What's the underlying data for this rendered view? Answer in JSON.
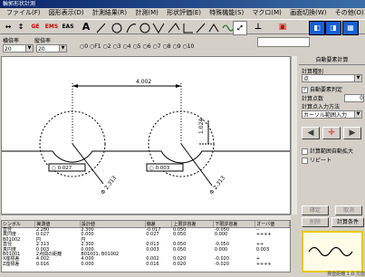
{
  "window": {
    "title": "輪郭形状計測"
  },
  "menu": [
    "ファイル(F)",
    "図形表示(D)",
    "計測結果(R)",
    "計測(M)",
    "形状評価(E)",
    "特殊機能(S)",
    "マクロ(M)",
    "画面切換(W)",
    "その他(O)"
  ],
  "toolbar": {
    "ge": "GE",
    "ems": "EMS",
    "eas": "EAS",
    "a": "A"
  },
  "row3": {
    "label1": "横倍率",
    "label2": "縦倍率",
    "combo1": "20",
    "combo2": "20",
    "radio_options": [
      "0",
      "F1",
      "2",
      "3",
      "4",
      "5",
      "6",
      "7",
      "8",
      "9",
      "10"
    ]
  },
  "drawing": {
    "dim_top": "4.002",
    "dim_right": "1.024",
    "box_left": "0.027",
    "box_mid": "0.003",
    "diag_left": "Φ 2.313",
    "diag_right": "Φ 2.313"
  },
  "table": {
    "headers": [
      "シンボル",
      "実測値",
      "設計値",
      "偏差",
      "上限許容差",
      "下限許容差",
      "オーバ値",
      "+"
    ],
    "rows": [
      [
        "直径",
        "2.280",
        "2.300",
        "-0.017",
        "0.050",
        "-0.050",
        "--"
      ],
      [
        "真円度",
        "0.027",
        "0.000",
        "0.027",
        "0.050",
        "0.000",
        "++++"
      ],
      [
        "B01002",
        "円",
        "円",
        "",
        "",
        "",
        ""
      ],
      [
        "直径",
        "2.313",
        "2.300",
        "0.013",
        "0.050",
        "-0.050",
        "++"
      ],
      [
        "真円度",
        "0.003",
        "0.000",
        "0.003",
        "0.050",
        "0.000",
        "0.003"
      ],
      [
        "B01001",
        "2点間の距離",
        "B01001, B01002",
        "",
        "",
        "",
        ""
      ],
      [
        "X座標差",
        "4.002",
        "4.000",
        "0.002",
        "0.020",
        "-0.020",
        "+"
      ],
      [
        "Z座標差",
        "0.016",
        "0.000",
        "0.016",
        "0.020",
        "-0.020",
        "++++"
      ]
    ]
  },
  "right_panel": {
    "title": "自動要素計算",
    "calc_type_label": "計算種別",
    "calc_type_value": "点",
    "auto_judge": "自動要素判定",
    "calc_count_label": "計算点数",
    "calc_count_value": "0",
    "input_method_label": "計算点入力方法",
    "input_method_value": "カーソル範囲入力",
    "range_auto": "計算範囲自動拡大",
    "repeat": "リピート",
    "btn_fix": "確定",
    "btn_cancel": "取消",
    "btn_delete": "削除",
    "btn_calc_cond": "計算条件",
    "status": "検査距離 1 Ω 欠歯"
  },
  "colors": {
    "accent": "#0a246a",
    "preview_border": "#e8c800",
    "arrow_red": "#d01818"
  }
}
